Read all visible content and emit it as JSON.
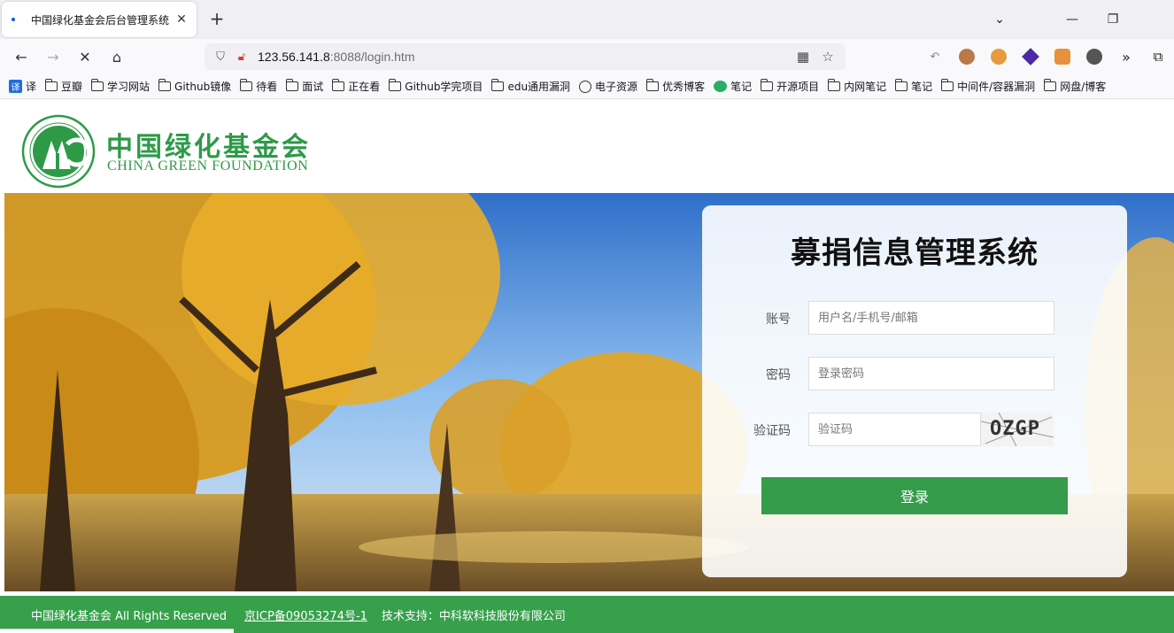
{
  "browser": {
    "tab_title": "中国绿化基金会后台管理系统",
    "url_host": "123.56.141.8",
    "url_rest": ":8088/login.htm",
    "bookmarks": [
      {
        "label": "译",
        "icon": "translate-icon"
      },
      {
        "label": "豆瓣",
        "icon": "folder-icon"
      },
      {
        "label": "学习网站",
        "icon": "folder-icon"
      },
      {
        "label": "Github镜像",
        "icon": "folder-icon"
      },
      {
        "label": "待看",
        "icon": "folder-icon"
      },
      {
        "label": "面试",
        "icon": "folder-icon"
      },
      {
        "label": "正在看",
        "icon": "folder-icon"
      },
      {
        "label": "Github学完项目",
        "icon": "folder-icon"
      },
      {
        "label": "edu通用漏洞",
        "icon": "folder-icon"
      },
      {
        "label": "电子资源",
        "icon": "globe-icon"
      },
      {
        "label": "优秀博客",
        "icon": "folder-icon"
      },
      {
        "label": "笔记",
        "icon": "wechat-icon"
      },
      {
        "label": "开源项目",
        "icon": "folder-icon"
      },
      {
        "label": "内网笔记",
        "icon": "folder-icon"
      },
      {
        "label": "笔记",
        "icon": "folder-icon"
      },
      {
        "label": "中间件/容器漏洞",
        "icon": "folder-icon"
      },
      {
        "label": "网盘/博客",
        "icon": "folder-icon"
      }
    ]
  },
  "header": {
    "brand_cn": "中国绿化基金会",
    "brand_en": "CHINA GREEN FOUNDATION"
  },
  "login": {
    "title": "募捐信息管理系统",
    "account_label": "账号",
    "account_placeholder": "用户名/手机号/邮箱",
    "password_label": "密码",
    "password_placeholder": "登录密码",
    "captcha_label": "验证码",
    "captcha_placeholder": "验证码",
    "captcha_text": "OZGP",
    "submit_label": "登录"
  },
  "footer": {
    "copyright": "中国绿化基金会 All Rights Reserved",
    "icp": "京ICP备09053274号-1",
    "tech_support": "技术支持：中科软科技股份有限公司"
  },
  "colors": {
    "brand_green": "#2e9a48",
    "button_green": "#349c4b",
    "footer_green": "#36a04b"
  }
}
